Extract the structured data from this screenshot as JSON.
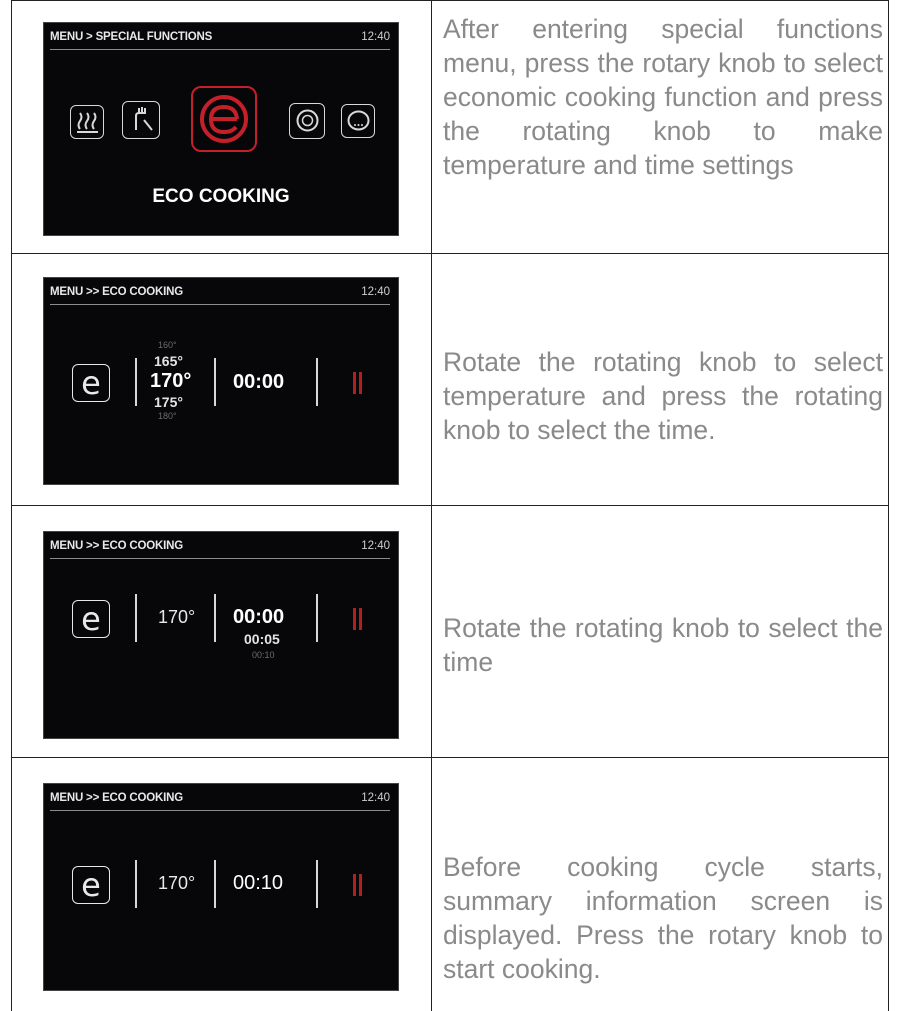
{
  "rows": [
    {
      "screen": {
        "header_left": "MENU > SPECIAL FUNCTIONS",
        "header_right": "12:40",
        "label": "ECO COOKING",
        "icons": [
          "steam-icon",
          "hand-cleaning-icon",
          "eco-icon",
          "defrost-icon",
          "more-icon"
        ]
      },
      "description": "After entering special functions menu, press the rotary knob to select economic cooking function and press the rotating knob to make temperature and time settings"
    },
    {
      "screen": {
        "header_left": "MENU >> ECO COOKING",
        "header_right": "12:40",
        "temp_list": [
          "160°",
          "165°",
          "170°",
          "175°",
          "180°"
        ],
        "time": "00:00"
      },
      "description": "Rotate the rotating knob to select temperature and press the rotating knob to select the time."
    },
    {
      "screen": {
        "header_left": "MENU >> ECO COOKING",
        "header_right": "12:40",
        "temp": "170°",
        "time_list": [
          "00:00",
          "00:05",
          "00:10"
        ]
      },
      "description": "Rotate the rotating knob to select the time"
    },
    {
      "screen": {
        "header_left": "MENU >> ECO COOKING",
        "header_right": "12:40",
        "temp": "170°",
        "time": "00:10"
      },
      "description": "Before cooking cycle starts, summary information screen is displayed. Press the rotary knob to start cooking."
    }
  ],
  "colors": {
    "description_text": "#8a8a8a",
    "screen_bg": "#07070a",
    "eco_red": "#c4202a",
    "pause_red": "#b02020"
  }
}
